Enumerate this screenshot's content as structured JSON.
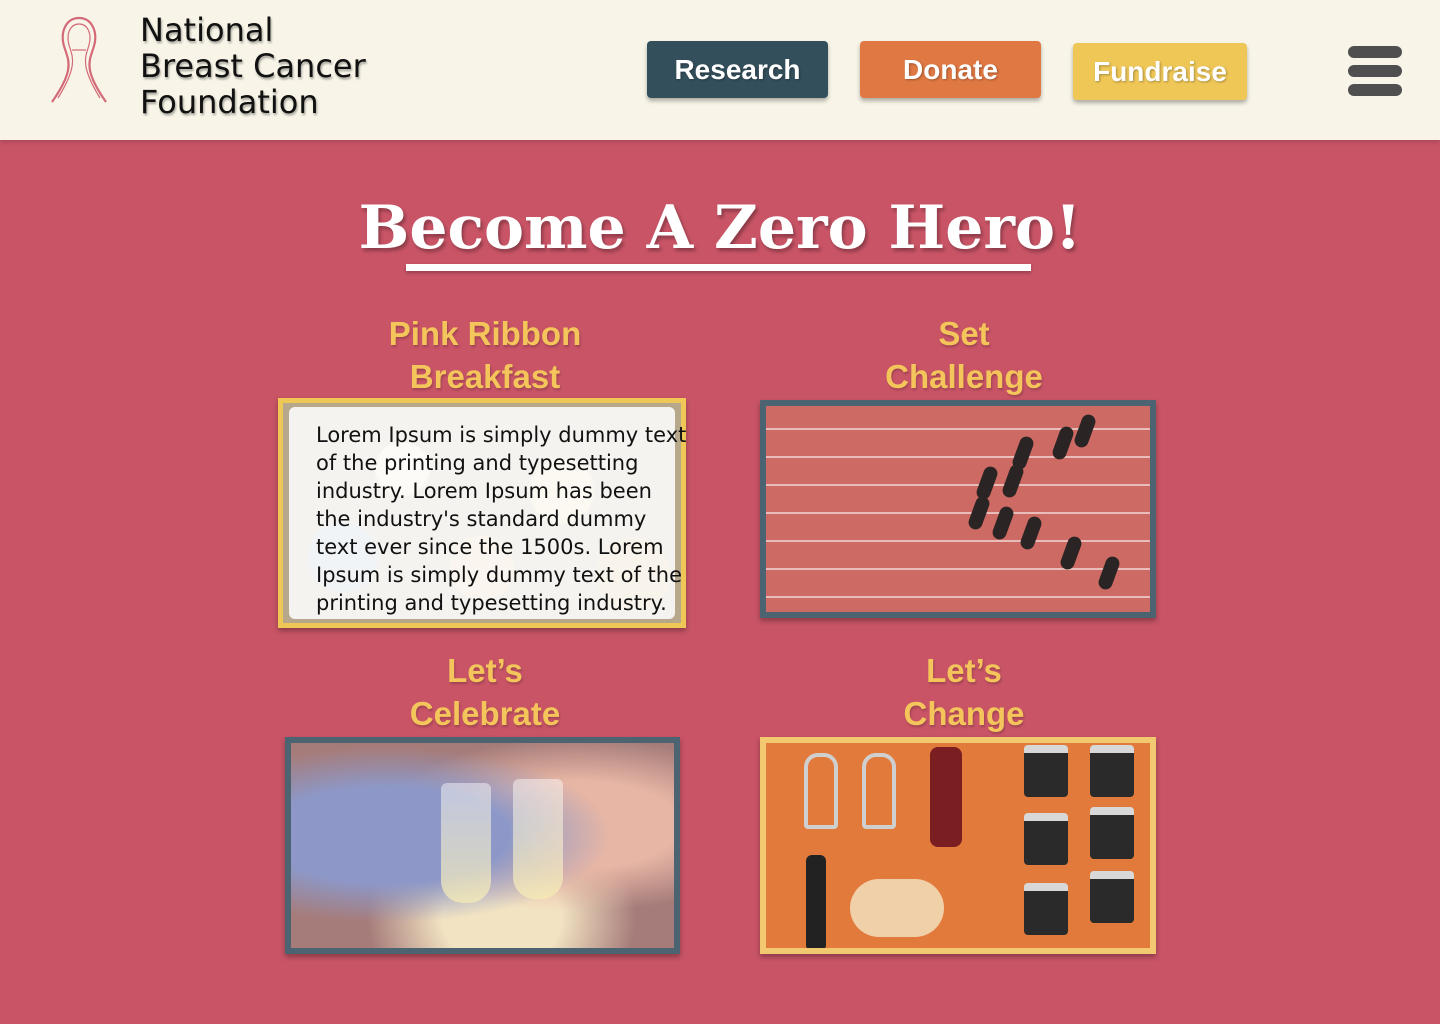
{
  "header": {
    "org_name": [
      "National",
      "Breast Cancer",
      "Foundation"
    ],
    "logo_icon": "pink-ribbon-icon",
    "nav": {
      "research": "Research",
      "donate": "Donate",
      "fundraise": "Fundraise"
    },
    "menu_icon": "hamburger-menu-icon",
    "colors": {
      "research": "#344f5c",
      "donate": "#e07843",
      "fundraise": "#efc757",
      "background": "#f8f5e8"
    }
  },
  "hero": {
    "title": "Become A Zero Hero!"
  },
  "cards": [
    {
      "title_lines": [
        "Pink Ribbon",
        "Breakfast"
      ],
      "description": "Lorem Ipsum is simply dummy text of the printing and typesetting industry. Lorem Ipsum has been the industry's standard dummy text ever since the 1500s. Lorem Ipsum is simply dummy text of the printing and typesetting industry."
    },
    {
      "title_lines": [
        "Set",
        "Challenge"
      ]
    },
    {
      "title_lines": [
        "Let’s",
        "Celebrate"
      ]
    },
    {
      "title_lines": [
        "Let’s",
        "Change"
      ]
    }
  ],
  "theme": {
    "page_background": "#c85466",
    "card_title_color": "#f3c55a"
  }
}
